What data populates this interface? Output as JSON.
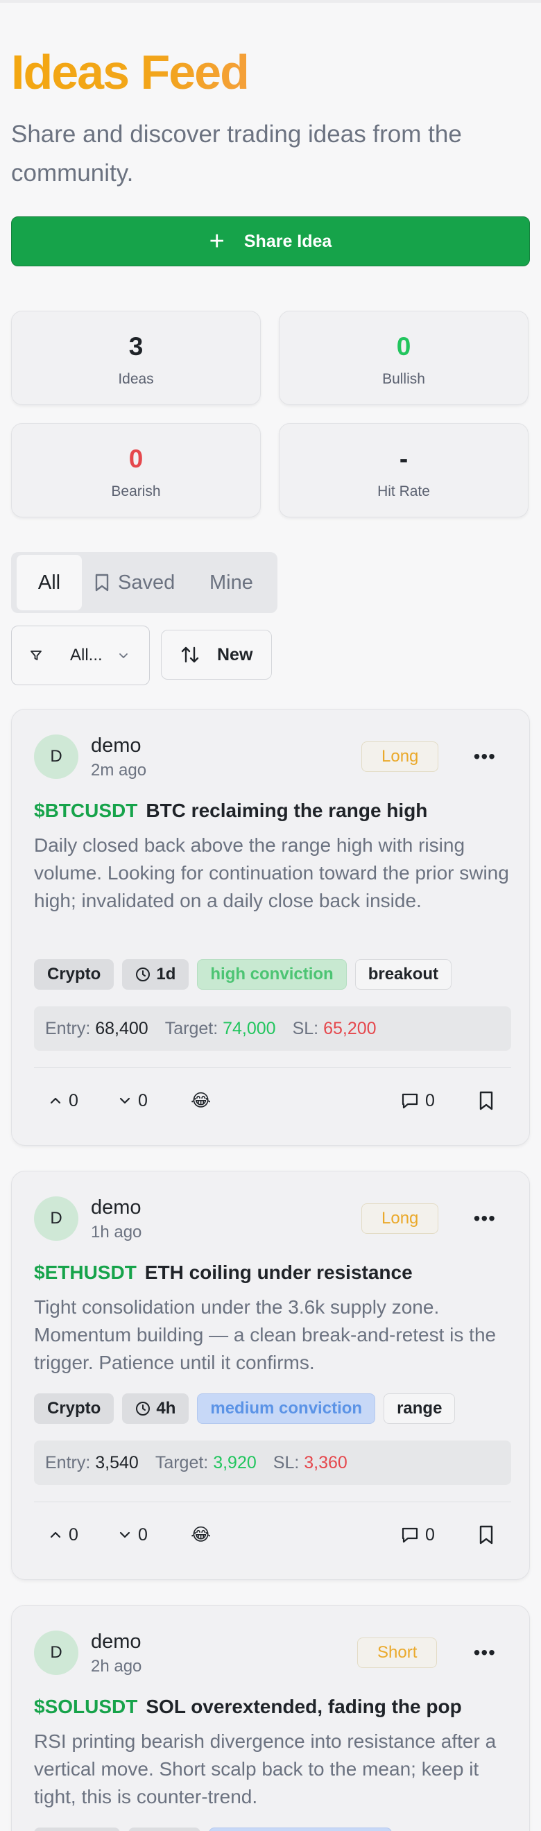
{
  "header": {
    "title": "Ideas Feed",
    "subtitle": "Share and discover trading ideas from the community.",
    "share_label": "Share Idea"
  },
  "stats": [
    {
      "value": "3",
      "label": "Ideas",
      "color": "#1f2328"
    },
    {
      "value": "0",
      "label": "Bullish",
      "color": "#22c55e"
    },
    {
      "value": "0",
      "label": "Bearish",
      "color": "#e5484d"
    },
    {
      "value": "-",
      "label": "Hit Rate",
      "color": "#1f2328"
    }
  ],
  "tabs": {
    "all": "All",
    "saved": "Saved",
    "mine": "Mine",
    "active": "All"
  },
  "filter": {
    "value": "All..."
  },
  "sort": {
    "label": "New"
  },
  "cards": [
    {
      "author": "demo",
      "avatar": "D",
      "time": "2m ago",
      "direction": "Long",
      "symbol": "$BTCUSDT",
      "title": "BTC reclaiming the range high",
      "body": "Daily closed back above the range high with rising volume. Looking for continuation toward the prior swing high; invalidated on a daily close back inside.",
      "tags": {
        "market": "Crypto",
        "timeframe": "1d",
        "conviction": "high conviction",
        "setup": "breakout"
      },
      "entry_label": "Entry:",
      "entry": "68,400",
      "target_label": "Target:",
      "target": "74,000",
      "sl_label": "SL:",
      "sl": "65,200",
      "upvotes": "0",
      "downvotes": "0",
      "reaction": "😂",
      "comments": "0"
    },
    {
      "author": "demo",
      "avatar": "D",
      "time": "1h ago",
      "direction": "Long",
      "symbol": "$ETHUSDT",
      "title": "ETH coiling under resistance",
      "body": "Tight consolidation under the 3.6k supply zone. Momentum building — a clean break-and-retest is the trigger. Patience until it confirms.",
      "tags": {
        "market": "Crypto",
        "timeframe": "4h",
        "conviction": "medium conviction",
        "setup": "range"
      },
      "entry_label": "Entry:",
      "entry": "3,540",
      "target_label": "Target:",
      "target": "3,920",
      "sl_label": "SL:",
      "sl": "3,360",
      "upvotes": "0",
      "downvotes": "0",
      "reaction": "😂",
      "comments": "0"
    },
    {
      "author": "demo",
      "avatar": "D",
      "time": "2h ago",
      "direction": "Short",
      "symbol": "$SOLUSDT",
      "title": "SOL overextended, fading the pop",
      "body": "RSI printing bearish divergence into resistance after a vertical move. Short scalp back to the mean; keep it tight, this is counter-trend."
    }
  ]
}
